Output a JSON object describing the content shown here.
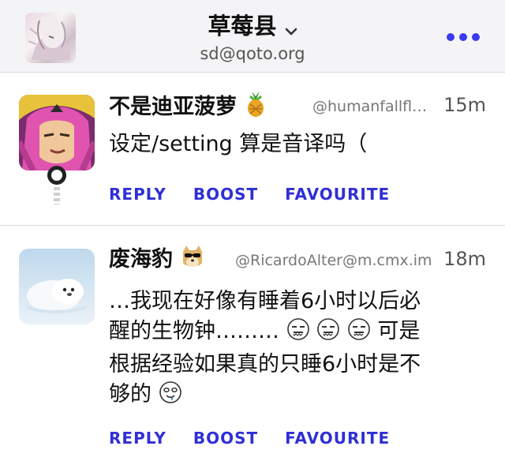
{
  "header": {
    "account_name": "草莓县",
    "account_handle": "sd@qoto.org",
    "accent_color": "#3a3af0"
  },
  "posts": [
    {
      "display_name": "不是迪亚菠萝",
      "name_emoji": "pineapple",
      "handle": "@humanfallflat…",
      "time": "15m",
      "content": "设定/setting 算是音译吗（",
      "actions": {
        "reply": "REPLY",
        "boost": "BOOST",
        "favourite": "FAVOURITE"
      }
    },
    {
      "display_name": "废海豹",
      "name_emoji": "doge-sunglasses",
      "handle": "@RicardoAlter@m.cmx.im",
      "time": "18m",
      "content_lines": [
        "…我现在好像有睡着6小时以后必",
        "醒的生物钟………",
        "可是",
        "根据经验如果真的只睡6小时是不",
        "够的"
      ],
      "actions": {
        "reply": "REPLY",
        "boost": "BOOST",
        "favourite": "FAVOURITE"
      }
    }
  ]
}
